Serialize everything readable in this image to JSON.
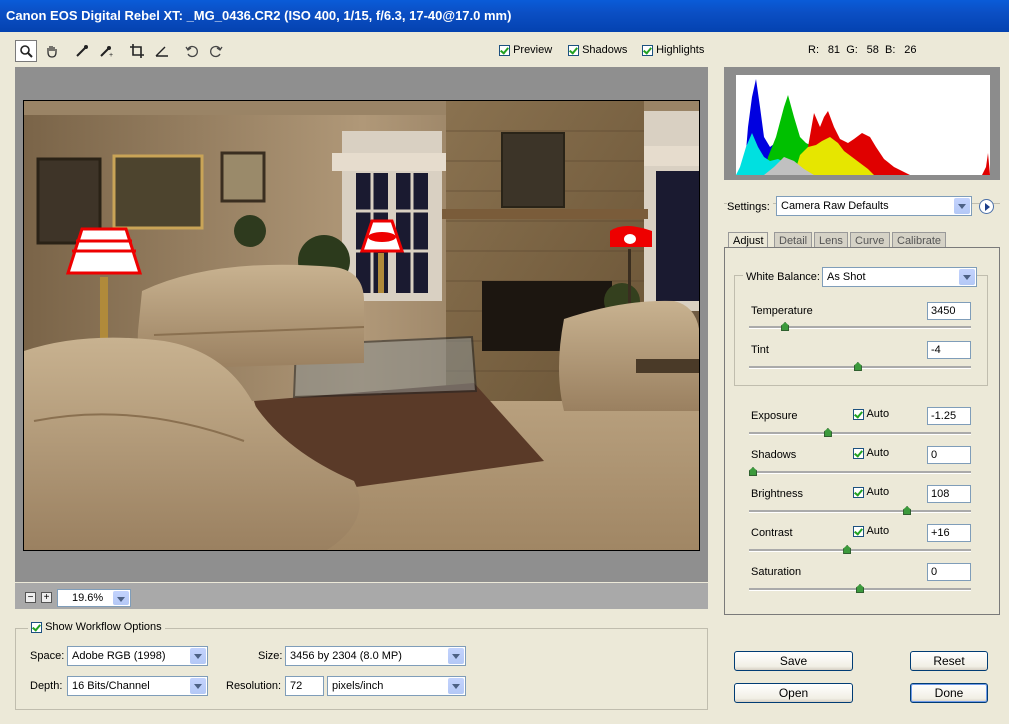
{
  "window": {
    "title": "Canon EOS Digital Rebel XT:  _MG_0436.CR2  (ISO 400, 1/15, f/6.3, 17-40@17.0 mm)"
  },
  "toolbar": {
    "preview_label": "Preview",
    "shadows_label": "Shadows",
    "highlights_label": "Highlights",
    "preview_checked": true,
    "shadows_checked": true,
    "highlights_checked": true
  },
  "rgb": {
    "r_label": "R:",
    "r": "81",
    "g_label": "G:",
    "g": "58",
    "b_label": "B:",
    "b": "26"
  },
  "zoom": {
    "value": "19.6%",
    "minus": "−",
    "plus": "+"
  },
  "workflow": {
    "show_label": "Show Workflow Options",
    "space_label": "Space:",
    "space_value": "Adobe RGB (1998)",
    "depth_label": "Depth:",
    "depth_value": "16 Bits/Channel",
    "size_label": "Size:",
    "size_value": "3456 by 2304  (8.0 MP)",
    "resolution_label": "Resolution:",
    "resolution_value": "72",
    "resolution_unit": "pixels/inch"
  },
  "settings": {
    "label": "Settings:",
    "value": "Camera Raw Defaults"
  },
  "tabs": [
    "Adjust",
    "Detail",
    "Lens",
    "Curve",
    "Calibrate"
  ],
  "white_balance": {
    "label": "White Balance:",
    "value": "As Shot"
  },
  "sliders": {
    "temperature": {
      "label": "Temperature",
      "value": "3450",
      "pos": 0.15
    },
    "tint": {
      "label": "Tint",
      "value": "-4",
      "pos": 0.49
    },
    "exposure": {
      "label": "Exposure",
      "value": "-1.25",
      "auto": "Auto",
      "pos": 0.35
    },
    "shadows": {
      "label": "Shadows",
      "value": "0",
      "auto": "Auto",
      "pos": 0.0
    },
    "brightness": {
      "label": "Brightness",
      "value": "108",
      "auto": "Auto",
      "pos": 0.72
    },
    "contrast": {
      "label": "Contrast",
      "value": "+16",
      "auto": "Auto",
      "pos": 0.44
    },
    "saturation": {
      "label": "Saturation",
      "value": "0",
      "pos": 0.5
    }
  },
  "buttons": {
    "save": "Save",
    "reset": "Reset",
    "open": "Open",
    "done": "Done"
  }
}
